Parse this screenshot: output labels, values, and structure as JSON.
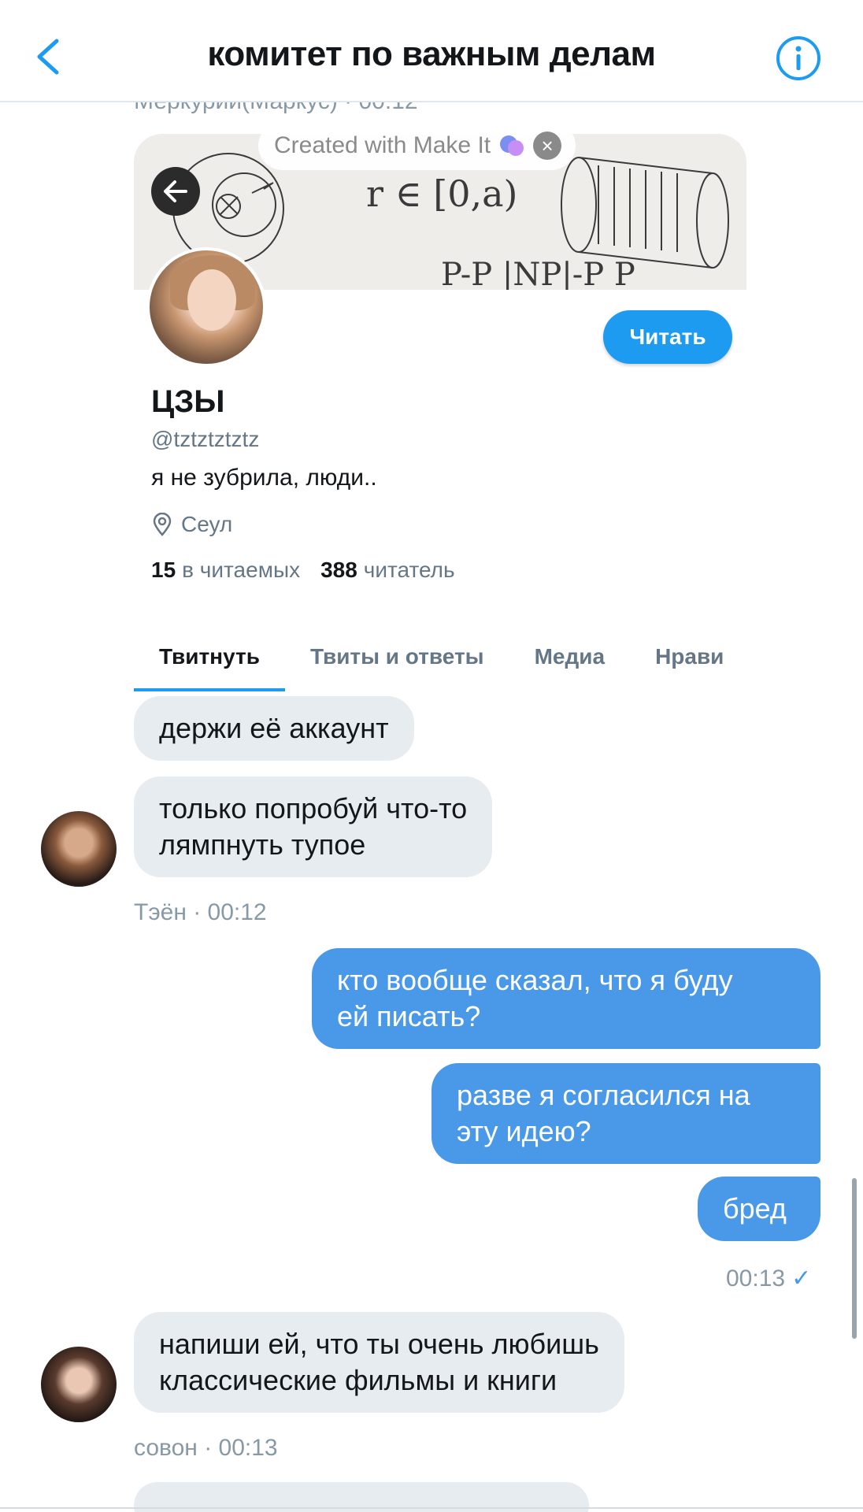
{
  "header": {
    "title": "комитет по важным делам",
    "back_icon": "chevron-left-icon",
    "info_icon": "info-circle-icon"
  },
  "cut_sender": "Меркурий(Маркус) · 00:12",
  "watermark": {
    "text": "Created with Make It",
    "close_icon": "close-icon"
  },
  "profile_card": {
    "name": "ЦЗЫ",
    "handle": "@tztztztztz",
    "bio": "я не зубрила, люди..",
    "location": "Сеул",
    "following_count": "15",
    "following_label": "в читаемых",
    "followers_count": "388",
    "followers_label": "читатель",
    "follow_button": "Читать",
    "tabs": [
      "Твитнуть",
      "Твиты и ответы",
      "Медиа",
      "Нрави"
    ]
  },
  "messages": {
    "m1": "держи её аккаунт",
    "m2_line1": "только попробуй что-то",
    "m2_line2": "лямпнуть тупое",
    "meta1": "Тэён  · 00:12",
    "m3_line1": "кто вообще сказал, что я буду",
    "m3_line2": "ей писать?",
    "m4_line1": "разве я согласился на",
    "m4_line2": "эту идею?",
    "m5": "бред",
    "meta2": "00:13",
    "m6_line1": "напиши ей, что ты очень любишь",
    "m6_line2": "классические фильмы и книги",
    "meta3": "совон  · 00:13"
  },
  "colors": {
    "accent": "#1d9bf0",
    "outgoing_bubble": "#4a99e9",
    "incoming_bubble": "#e6ecf0"
  }
}
